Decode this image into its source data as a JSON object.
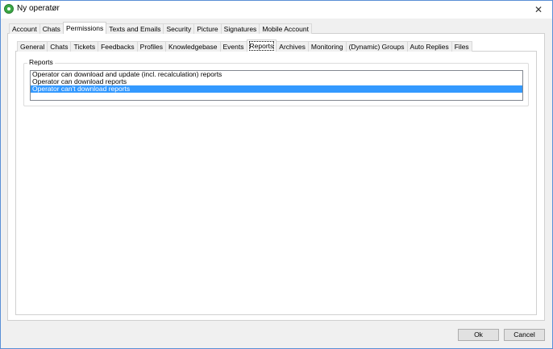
{
  "window": {
    "title": "Ny operatør"
  },
  "main_tabs": [
    {
      "label": "Account",
      "active": false
    },
    {
      "label": "Chats",
      "active": false
    },
    {
      "label": "Permissions",
      "active": true
    },
    {
      "label": "Texts and Emails",
      "active": false
    },
    {
      "label": "Security",
      "active": false
    },
    {
      "label": "Picture",
      "active": false
    },
    {
      "label": "Signatures",
      "active": false
    },
    {
      "label": "Mobile Account",
      "active": false
    }
  ],
  "sub_tabs": [
    {
      "label": "General",
      "active": false
    },
    {
      "label": "Chats",
      "active": false
    },
    {
      "label": "Tickets",
      "active": false
    },
    {
      "label": "Feedbacks",
      "active": false
    },
    {
      "label": "Profiles",
      "active": false
    },
    {
      "label": "Knowledgebase",
      "active": false
    },
    {
      "label": "Events",
      "active": false
    },
    {
      "label": "Reports",
      "active": true
    },
    {
      "label": "Archives",
      "active": false
    },
    {
      "label": "Monitoring",
      "active": false
    },
    {
      "label": "(Dynamic) Groups",
      "active": false
    },
    {
      "label": "Auto Replies",
      "active": false
    },
    {
      "label": "Files",
      "active": false
    }
  ],
  "reports_group": {
    "label": "Reports",
    "options": [
      {
        "label": "Operator can download and update (incl. recalculation) reports",
        "selected": false
      },
      {
        "label": "Operator can download reports",
        "selected": false
      },
      {
        "label": "Operator can't download reports",
        "selected": true
      }
    ]
  },
  "footer": {
    "ok_label": "Ok",
    "cancel_label": "Cancel"
  }
}
